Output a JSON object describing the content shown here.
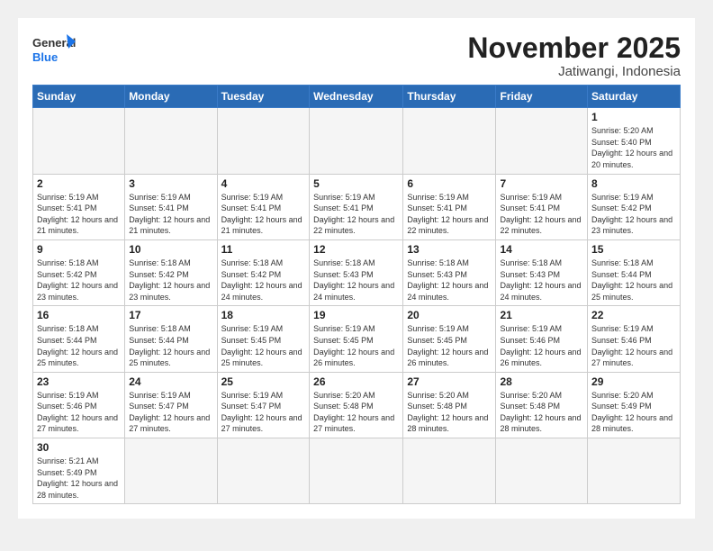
{
  "header": {
    "logo_general": "General",
    "logo_blue": "Blue",
    "month_title": "November 2025",
    "subtitle": "Jatiwangi, Indonesia"
  },
  "weekdays": [
    "Sunday",
    "Monday",
    "Tuesday",
    "Wednesday",
    "Thursday",
    "Friday",
    "Saturday"
  ],
  "days": [
    {
      "number": "",
      "info": ""
    },
    {
      "number": "",
      "info": ""
    },
    {
      "number": "",
      "info": ""
    },
    {
      "number": "",
      "info": ""
    },
    {
      "number": "",
      "info": ""
    },
    {
      "number": "",
      "info": ""
    },
    {
      "number": "1",
      "info": "Sunrise: 5:20 AM\nSunset: 5:40 PM\nDaylight: 12 hours\nand 20 minutes."
    },
    {
      "number": "2",
      "info": "Sunrise: 5:19 AM\nSunset: 5:41 PM\nDaylight: 12 hours\nand 21 minutes."
    },
    {
      "number": "3",
      "info": "Sunrise: 5:19 AM\nSunset: 5:41 PM\nDaylight: 12 hours\nand 21 minutes."
    },
    {
      "number": "4",
      "info": "Sunrise: 5:19 AM\nSunset: 5:41 PM\nDaylight: 12 hours\nand 21 minutes."
    },
    {
      "number": "5",
      "info": "Sunrise: 5:19 AM\nSunset: 5:41 PM\nDaylight: 12 hours\nand 22 minutes."
    },
    {
      "number": "6",
      "info": "Sunrise: 5:19 AM\nSunset: 5:41 PM\nDaylight: 12 hours\nand 22 minutes."
    },
    {
      "number": "7",
      "info": "Sunrise: 5:19 AM\nSunset: 5:41 PM\nDaylight: 12 hours\nand 22 minutes."
    },
    {
      "number": "8",
      "info": "Sunrise: 5:19 AM\nSunset: 5:42 PM\nDaylight: 12 hours\nand 23 minutes."
    },
    {
      "number": "9",
      "info": "Sunrise: 5:18 AM\nSunset: 5:42 PM\nDaylight: 12 hours\nand 23 minutes."
    },
    {
      "number": "10",
      "info": "Sunrise: 5:18 AM\nSunset: 5:42 PM\nDaylight: 12 hours\nand 23 minutes."
    },
    {
      "number": "11",
      "info": "Sunrise: 5:18 AM\nSunset: 5:42 PM\nDaylight: 12 hours\nand 24 minutes."
    },
    {
      "number": "12",
      "info": "Sunrise: 5:18 AM\nSunset: 5:43 PM\nDaylight: 12 hours\nand 24 minutes."
    },
    {
      "number": "13",
      "info": "Sunrise: 5:18 AM\nSunset: 5:43 PM\nDaylight: 12 hours\nand 24 minutes."
    },
    {
      "number": "14",
      "info": "Sunrise: 5:18 AM\nSunset: 5:43 PM\nDaylight: 12 hours\nand 24 minutes."
    },
    {
      "number": "15",
      "info": "Sunrise: 5:18 AM\nSunset: 5:44 PM\nDaylight: 12 hours\nand 25 minutes."
    },
    {
      "number": "16",
      "info": "Sunrise: 5:18 AM\nSunset: 5:44 PM\nDaylight: 12 hours\nand 25 minutes."
    },
    {
      "number": "17",
      "info": "Sunrise: 5:18 AM\nSunset: 5:44 PM\nDaylight: 12 hours\nand 25 minutes."
    },
    {
      "number": "18",
      "info": "Sunrise: 5:19 AM\nSunset: 5:45 PM\nDaylight: 12 hours\nand 25 minutes."
    },
    {
      "number": "19",
      "info": "Sunrise: 5:19 AM\nSunset: 5:45 PM\nDaylight: 12 hours\nand 26 minutes."
    },
    {
      "number": "20",
      "info": "Sunrise: 5:19 AM\nSunset: 5:45 PM\nDaylight: 12 hours\nand 26 minutes."
    },
    {
      "number": "21",
      "info": "Sunrise: 5:19 AM\nSunset: 5:46 PM\nDaylight: 12 hours\nand 26 minutes."
    },
    {
      "number": "22",
      "info": "Sunrise: 5:19 AM\nSunset: 5:46 PM\nDaylight: 12 hours\nand 27 minutes."
    },
    {
      "number": "23",
      "info": "Sunrise: 5:19 AM\nSunset: 5:46 PM\nDaylight: 12 hours\nand 27 minutes."
    },
    {
      "number": "24",
      "info": "Sunrise: 5:19 AM\nSunset: 5:47 PM\nDaylight: 12 hours\nand 27 minutes."
    },
    {
      "number": "25",
      "info": "Sunrise: 5:19 AM\nSunset: 5:47 PM\nDaylight: 12 hours\nand 27 minutes."
    },
    {
      "number": "26",
      "info": "Sunrise: 5:20 AM\nSunset: 5:48 PM\nDaylight: 12 hours\nand 27 minutes."
    },
    {
      "number": "27",
      "info": "Sunrise: 5:20 AM\nSunset: 5:48 PM\nDaylight: 12 hours\nand 28 minutes."
    },
    {
      "number": "28",
      "info": "Sunrise: 5:20 AM\nSunset: 5:48 PM\nDaylight: 12 hours\nand 28 minutes."
    },
    {
      "number": "29",
      "info": "Sunrise: 5:20 AM\nSunset: 5:49 PM\nDaylight: 12 hours\nand 28 minutes."
    },
    {
      "number": "30",
      "info": "Sunrise: 5:21 AM\nSunset: 5:49 PM\nDaylight: 12 hours\nand 28 minutes."
    }
  ]
}
